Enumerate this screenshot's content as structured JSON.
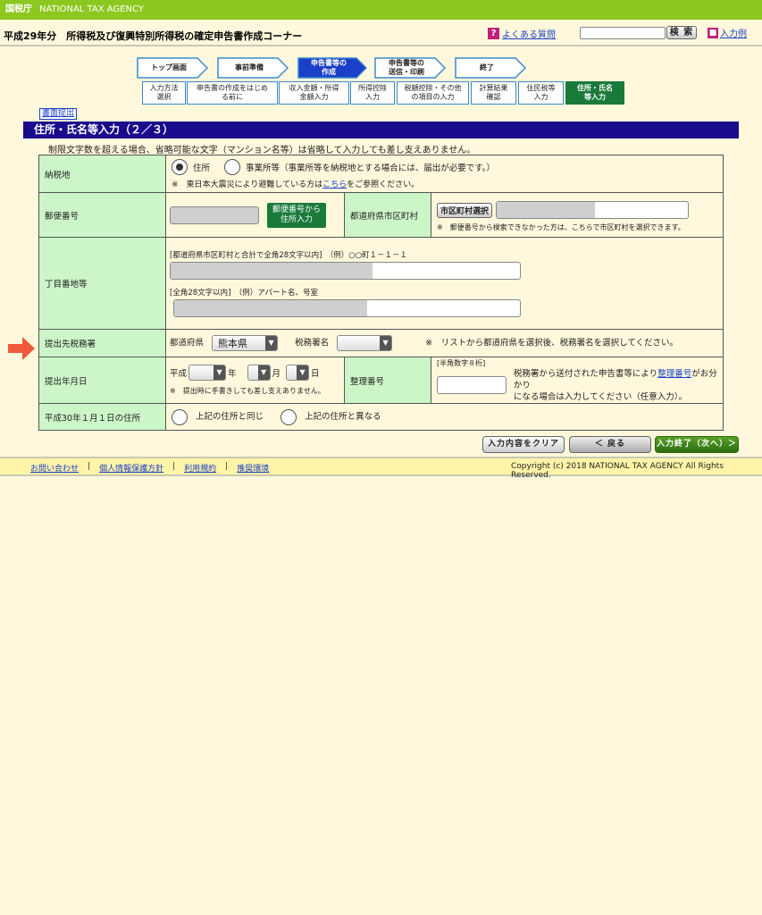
{
  "topbar": {
    "agency_jp": "国税庁",
    "agency_en": "NATIONAL TAX AGENCY"
  },
  "header": {
    "corner_title": "平成29年分　所得税及び復興特別所得税の確定申告書作成コーナー",
    "faq_label": "よくある質問",
    "search_button": "検 索",
    "example_label": "入力例"
  },
  "steps": [
    {
      "label": "トップ画面",
      "active": false
    },
    {
      "label": "事前準備",
      "active": false
    },
    {
      "label": "申告書等の\n作成",
      "active": true
    },
    {
      "label": "申告書等の\n送信・印刷",
      "active": false
    },
    {
      "label": "終了",
      "active": false
    }
  ],
  "substeps": [
    {
      "label": "入力方法\n選択",
      "active": false
    },
    {
      "label": "申告書の作成をはじめ\nる前に",
      "active": false
    },
    {
      "label": "収入金額・所得\n金額入力",
      "active": false
    },
    {
      "label": "所得控除\n入力",
      "active": false
    },
    {
      "label": "税額控除・その他\nの項目の入力",
      "active": false
    },
    {
      "label": "計算結果\n確認",
      "active": false
    },
    {
      "label": "住民税等\n入力",
      "active": false
    },
    {
      "label": "住所・氏名\n等入力",
      "active": true
    }
  ],
  "submit_doc_label": "書面提出",
  "page_title": "住所・氏名等入力（２／３）",
  "notice": "制限文字数を超える場合、省略可能な文字（マンション名等）は省略して入力しても差し支えありません。",
  "form": {
    "tax_place": {
      "label": "納税地",
      "opt_address": "住所",
      "opt_office": "事業所等（事業所等を納税地とする場合には、届出が必要です。）",
      "note_prefix": "※　東日本大震災により避難している方は",
      "note_link": "こちら",
      "note_suffix": "をご参照ください。"
    },
    "postal": {
      "label": "郵便番号",
      "button": "郵便番号から\n住所入力",
      "pref_label": "都道府県市区町村",
      "city_button": "市区町村選択",
      "note": "※　郵便番号から検索できなかった方は、こちらで市区町村を選択できます。"
    },
    "street": {
      "label": "丁目番地等",
      "hint1": "[都道府県市区町村と合計で全角28文字以内]　（例）○○町１－１－１",
      "hint2": "[全角28文字以内]　（例）アパート名、号室"
    },
    "tax_office": {
      "label": "提出先税務署",
      "pref_label": "都道府県",
      "pref_value": "熊本県",
      "office_label": "税務署名",
      "note": "※　リストから都道府県を選択後、税務署名を選択してください。"
    },
    "submit_date": {
      "label": "提出年月日",
      "era": "平成",
      "year": "年",
      "month": "月",
      "day": "日",
      "note": "※　提出時に手書きしても差し支えありません。",
      "ref_label": "整理番号",
      "ref_hint": "[半角数字８桁]",
      "ref_note_prefix": "税務署から送付された申告書等により",
      "ref_note_link": "整理番号",
      "ref_note_suffix": "がお分かり",
      "ref_note_line2": "になる場合は入力してください（任意入力）。"
    },
    "h30_address": {
      "label": "平成30年１月１日の住所",
      "opt_same": "上記の住所と同じ",
      "opt_diff": "上記の住所と異なる"
    }
  },
  "buttons": {
    "clear": "入力内容をクリア",
    "back": "＜ 戻る",
    "next": "入力終了（次へ）＞"
  },
  "footer": {
    "links": [
      "お問い合わせ",
      "個人情報保護方針",
      "利用規約",
      "推奨環境"
    ],
    "copyright": "Copyright (c) 2018 NATIONAL TAX AGENCY All Rights Reserved."
  },
  "colors": {
    "topbar": "#8cc820",
    "title_bar": "#1a0a8c",
    "label_cell": "#ccf5c8",
    "active_step": "#1a7a3a",
    "arrow": "#f05a3c"
  }
}
